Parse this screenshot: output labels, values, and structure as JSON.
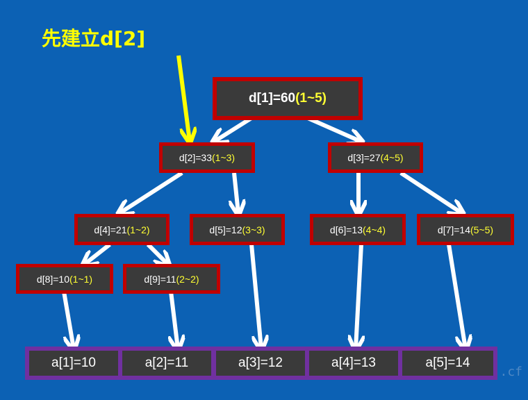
{
  "caption": "先建立d[2]",
  "watermark": ".cf",
  "colors": {
    "background": "#0c61b4",
    "node_fill": "#3a3a3a",
    "node_border": "#c00000",
    "leaf_border": "#7030a0",
    "range_text": "#ffff33",
    "arrow": "#ffffff",
    "highlight_arrow": "#ffff00"
  },
  "nodes": {
    "d1": {
      "label": "d[1]=60",
      "range": "(1~5)"
    },
    "d2": {
      "label": "d[2]=33",
      "range": "(1~3)"
    },
    "d3": {
      "label": "d[3]=27",
      "range": "(4~5)"
    },
    "d4": {
      "label": "d[4]=21",
      "range": "(1~2)"
    },
    "d5": {
      "label": "d[5]=12",
      "range": "(3~3)"
    },
    "d6": {
      "label": "d[6]=13",
      "range": "(4~4)"
    },
    "d7": {
      "label": "d[7]=14",
      "range": "(5~5)"
    },
    "d8": {
      "label": "d[8]=10",
      "range": "(1~1)"
    },
    "d9": {
      "label": "d[9]=11",
      "range": "(2~2)"
    }
  },
  "leaves": [
    "a[1]=10",
    "a[2]=11",
    "a[3]=12",
    "a[4]=13",
    "a[5]=14"
  ]
}
